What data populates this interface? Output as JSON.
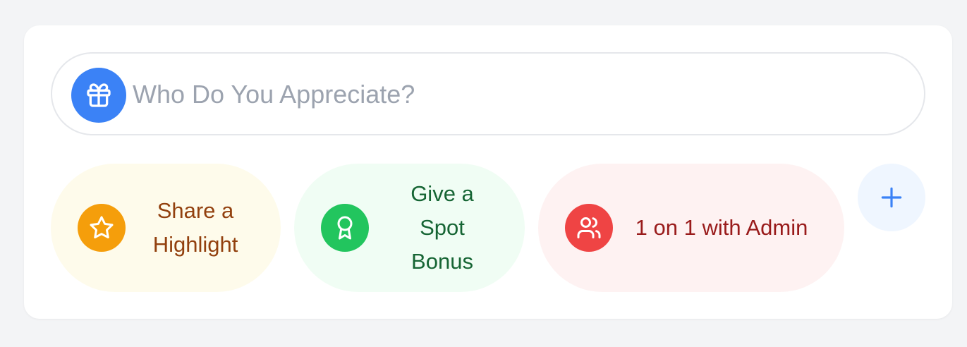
{
  "search": {
    "placeholder": "Who Do You Appreciate?",
    "value": "",
    "icon": "gift-icon"
  },
  "actions": [
    {
      "label": "Share a Highlight",
      "icon": "star-icon",
      "bg": "#fefbeb",
      "icon_bg": "#f59e0b",
      "text_color": "#92400e"
    },
    {
      "label": "Give a Spot Bonus",
      "icon": "award-icon",
      "bg": "#f0fdf4",
      "icon_bg": "#22c55e",
      "text_color": "#166534"
    },
    {
      "label": "1 on 1 with Admin",
      "icon": "users-icon",
      "bg": "#fef2f2",
      "icon_bg": "#ef4444",
      "text_color": "#991b1b"
    }
  ],
  "add_button": {
    "icon": "plus-icon",
    "color": "#3b82f6"
  },
  "colors": {
    "page_bg": "#f3f4f6",
    "card_bg": "#ffffff",
    "accent": "#3b82f6",
    "placeholder": "#9ca3af"
  }
}
